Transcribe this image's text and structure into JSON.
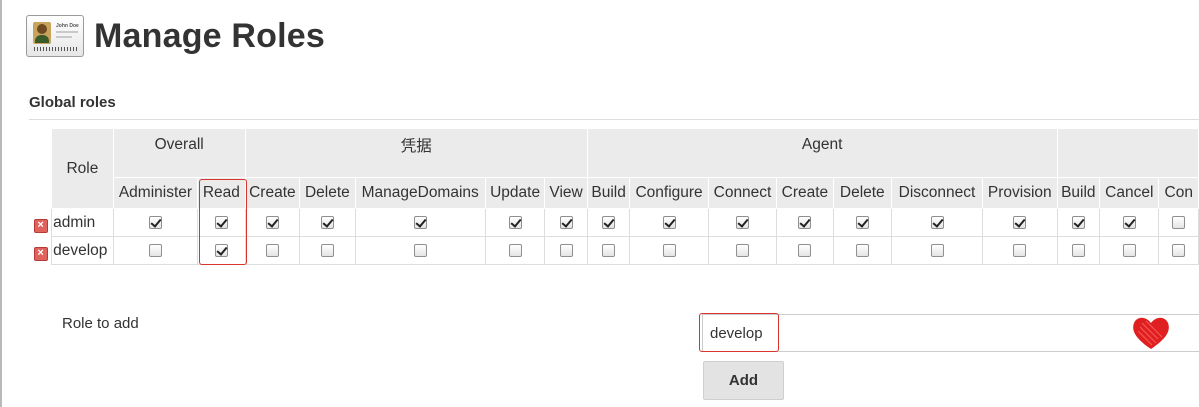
{
  "page": {
    "title": "Manage Roles"
  },
  "logo": {
    "name": "John Doe"
  },
  "global_roles": {
    "heading": "Global roles",
    "role_col_label": "Role",
    "categories": [
      "Overall",
      "凭据",
      "Agent",
      ""
    ],
    "permissions": [
      "Administer",
      "Read",
      "Create",
      "Delete",
      "ManageDomains",
      "Update",
      "View",
      "Build",
      "Configure",
      "Connect",
      "Create",
      "Delete",
      "Disconnect",
      "Provision",
      "Build",
      "Cancel",
      "Con"
    ],
    "roles": [
      {
        "name": "admin",
        "grants": [
          true,
          true,
          true,
          true,
          true,
          true,
          true,
          true,
          true,
          true,
          true,
          true,
          true,
          true,
          true,
          true,
          false
        ]
      },
      {
        "name": "develop",
        "grants": [
          false,
          true,
          false,
          false,
          false,
          false,
          false,
          false,
          false,
          false,
          false,
          false,
          false,
          false,
          false,
          false,
          false
        ]
      }
    ]
  },
  "add_role": {
    "label": "Role to add",
    "value": "develop",
    "button": "Add"
  },
  "colors": {
    "highlight": "#d9342b",
    "delete_icon": "#e0625d",
    "header_bg": "#ebebeb"
  }
}
